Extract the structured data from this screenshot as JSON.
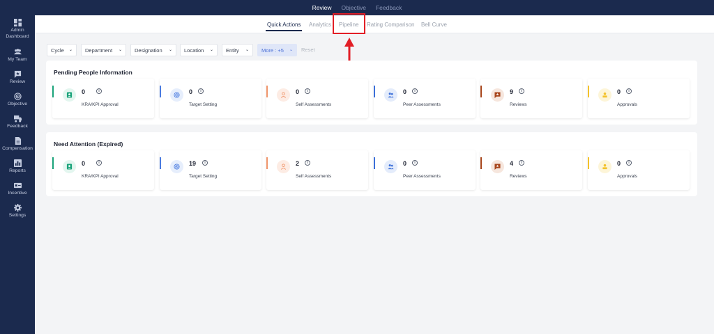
{
  "top_nav": {
    "items": [
      "Review",
      "Objective",
      "Feedback"
    ],
    "active": "Review"
  },
  "sidebar": {
    "items": [
      {
        "label": "Admin Dashboard",
        "icon": "dashboard-icon"
      },
      {
        "label": "My Team",
        "icon": "team-icon"
      },
      {
        "label": "Review",
        "icon": "review-icon"
      },
      {
        "label": "Objective",
        "icon": "target-icon"
      },
      {
        "label": "Feedback",
        "icon": "feedback-icon"
      },
      {
        "label": "Compensation",
        "icon": "document-icon"
      },
      {
        "label": "Reports",
        "icon": "reports-icon"
      },
      {
        "label": "Incentive",
        "icon": "incentive-icon"
      },
      {
        "label": "Settings",
        "icon": "gear-icon"
      }
    ]
  },
  "tabs": [
    {
      "label": "Quick Actions",
      "active": true
    },
    {
      "label": "Analytics",
      "active": false
    },
    {
      "label": "Pipeline",
      "active": false
    },
    {
      "label": "Rating Comparison",
      "active": false
    },
    {
      "label": "Bell Curve",
      "active": false
    }
  ],
  "filters": {
    "cycle": "Cycle",
    "department": "Department",
    "designation": "Designation",
    "location": "Location",
    "entity": "Entity",
    "more": "More : +5",
    "reset": "Reset"
  },
  "pending": {
    "title": "Pending People Information",
    "cards": [
      {
        "count": "0",
        "label": "KRA/KPI Approval"
      },
      {
        "count": "0",
        "label": "Target Setting"
      },
      {
        "count": "0",
        "label": "Self Assessments"
      },
      {
        "count": "0",
        "label": "Peer Assessments"
      },
      {
        "count": "9",
        "label": "Reviews"
      },
      {
        "count": "0",
        "label": "Approvals"
      }
    ]
  },
  "attention": {
    "title": "Need Attention (Expired)",
    "cards": [
      {
        "count": "0",
        "label": "KRA/KPI Approval"
      },
      {
        "count": "19",
        "label": "Target Setting"
      },
      {
        "count": "2",
        "label": "Self Assessments"
      },
      {
        "count": "0",
        "label": "Peer Assessments"
      },
      {
        "count": "4",
        "label": "Reviews"
      },
      {
        "count": "0",
        "label": "Approvals"
      }
    ]
  },
  "card_colors": {
    "kra": {
      "accent": "#1aa37a",
      "bg": "#e3f6ef"
    },
    "target": {
      "accent": "#4a7be0",
      "bg": "#e6eefc"
    },
    "self": {
      "accent": "#f0956a",
      "bg": "#fdece4"
    },
    "peer": {
      "accent": "#3b6fd9",
      "bg": "#e4ecfb"
    },
    "reviews": {
      "accent": "#a8461c",
      "bg": "#f6e6dd"
    },
    "approvals": {
      "accent": "#f3c22c",
      "bg": "#fdf5d8"
    }
  },
  "highlight_color": "#e21e26"
}
